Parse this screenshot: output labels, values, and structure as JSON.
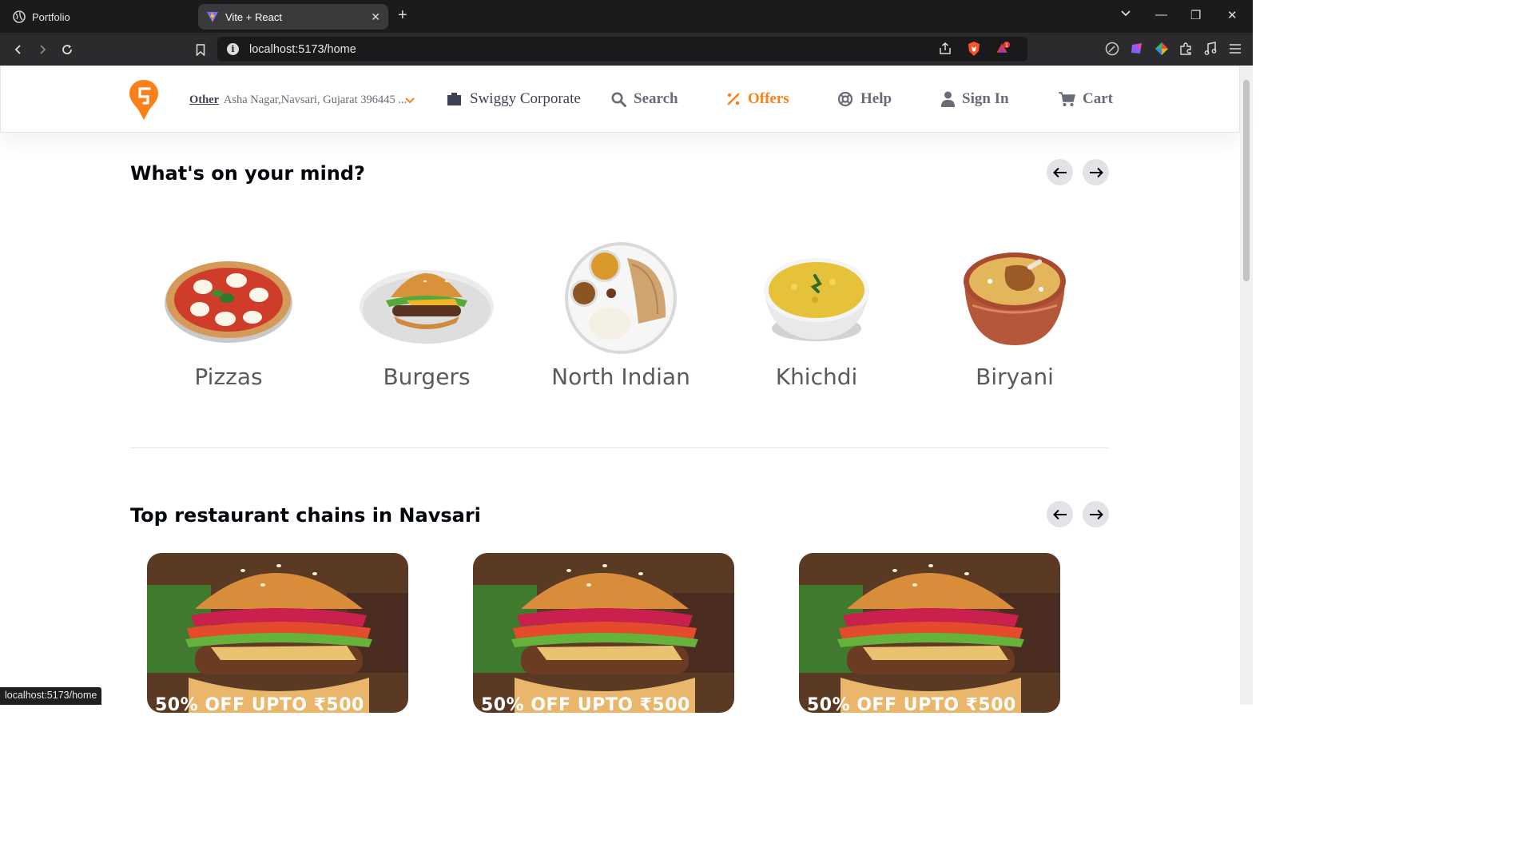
{
  "browser": {
    "tabs": [
      {
        "title": "Portfolio",
        "active": false,
        "icon": "globe-icon"
      },
      {
        "title": "Vite + React",
        "active": true,
        "icon": "vite-icon"
      }
    ],
    "url": "localhost:5173/home",
    "brave_badge_count": "1",
    "status_url": "localhost:5173/home"
  },
  "header": {
    "location_type": "Other",
    "location_address": "Asha Nagar,Navsari, Gujarat 396445 ...",
    "nav": {
      "corporate": "Swiggy Corporate",
      "search": "Search",
      "offers": "Offers",
      "help": "Help",
      "signin": "Sign In",
      "cart": "Cart"
    },
    "accent_color": "#fc8019"
  },
  "mind_section": {
    "title": "What's on your mind?",
    "items": [
      {
        "label": "Pizzas",
        "icon": "pizza-image"
      },
      {
        "label": "Burgers",
        "icon": "burger-image"
      },
      {
        "label": "North Indian",
        "icon": "thali-image"
      },
      {
        "label": "Khichdi",
        "icon": "khichdi-image"
      },
      {
        "label": "Biryani",
        "icon": "biryani-image"
      }
    ]
  },
  "chains_section": {
    "title": "Top restaurant chains in Navsari",
    "cards": [
      {
        "offer": "50% OFF UPTO ₹500"
      },
      {
        "offer": "50% OFF UPTO ₹500"
      },
      {
        "offer": "50% OFF UPTO ₹500"
      }
    ]
  }
}
